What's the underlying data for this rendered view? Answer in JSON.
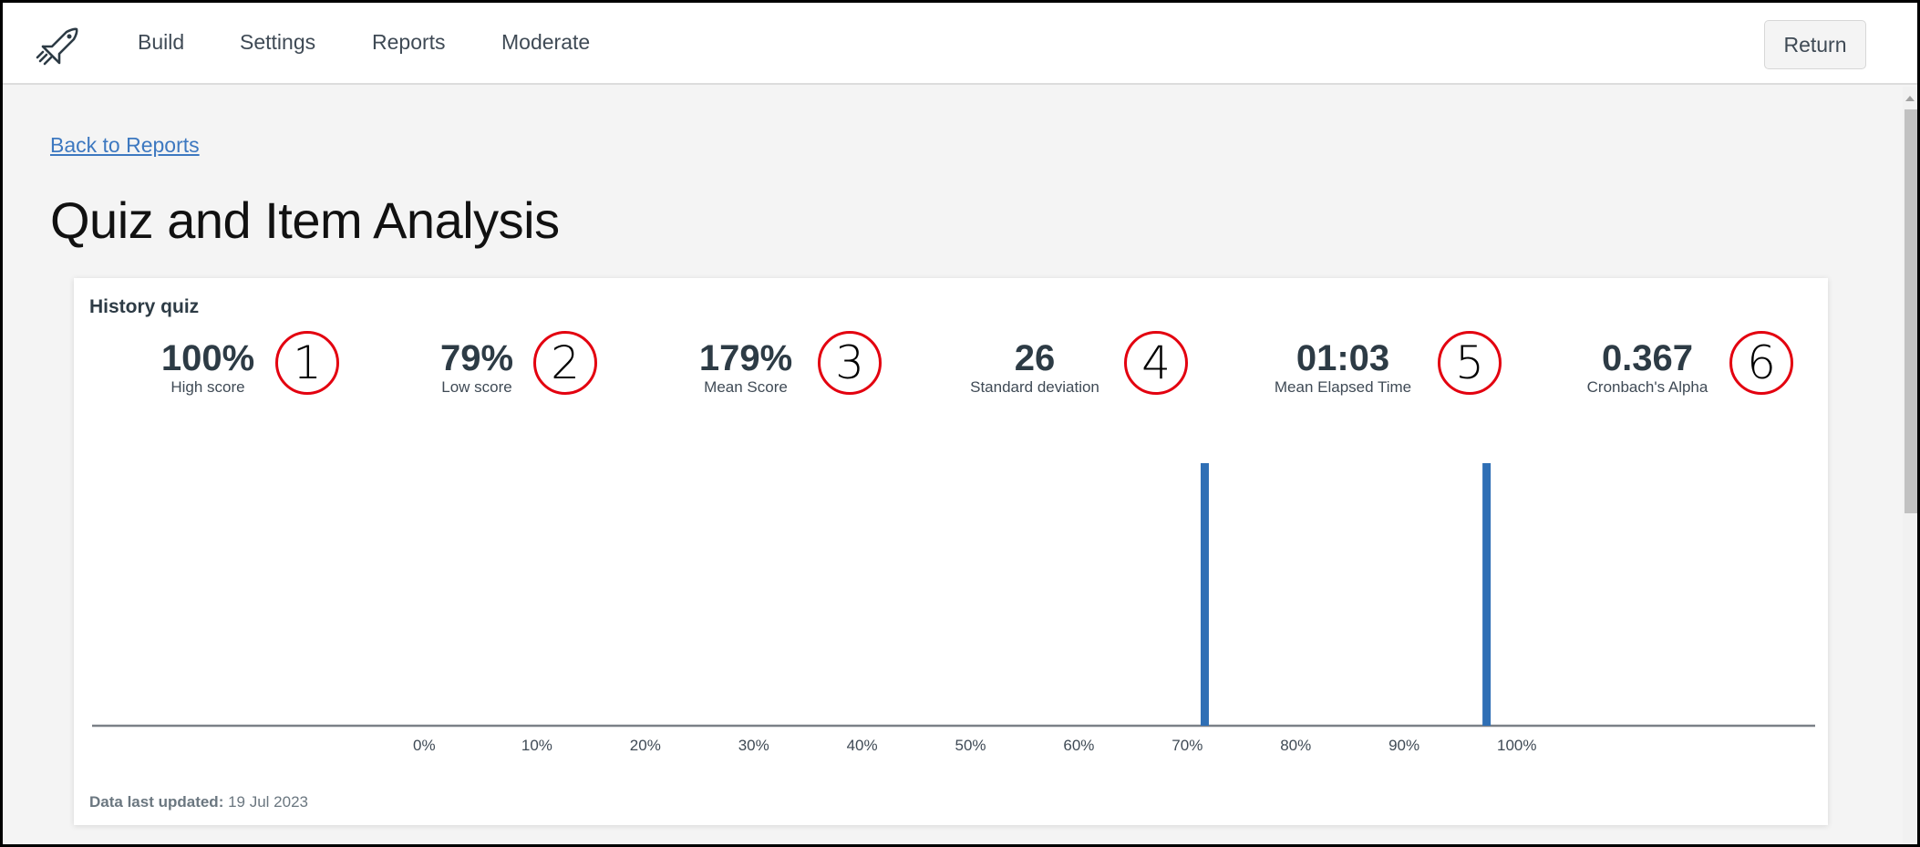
{
  "header": {
    "logo_icon": "rocket-icon",
    "nav": [
      {
        "label": "Build"
      },
      {
        "label": "Settings"
      },
      {
        "label": "Reports"
      },
      {
        "label": "Moderate"
      }
    ],
    "return_label": "Return"
  },
  "page": {
    "back_link": "Back to Reports",
    "title": "Quiz and Item Analysis"
  },
  "panel": {
    "quiz_name": "History quiz",
    "stats": [
      {
        "value": "100%",
        "label": "High score",
        "annotation": "1"
      },
      {
        "value": "79%",
        "label": "Low score",
        "annotation": "2"
      },
      {
        "value": "179%",
        "label": "Mean Score",
        "annotation": "3"
      },
      {
        "value": "26",
        "label": "Standard deviation",
        "annotation": "4"
      },
      {
        "value": "01:03",
        "label": "Mean Elapsed Time",
        "annotation": "5"
      },
      {
        "value": "0.367",
        "label": "Cronbach's Alpha",
        "annotation": "6"
      }
    ],
    "footer_label": "Data last updated:",
    "footer_value": "19 Jul 2023"
  },
  "colors": {
    "bar": "#2f6fb5",
    "axis": "#7b8087",
    "annotation": "#e3000f"
  },
  "chart_data": {
    "type": "bar",
    "title": "",
    "xlabel": "",
    "ylabel": "",
    "x_ticks": [
      "0%",
      "10%",
      "20%",
      "30%",
      "40%",
      "50%",
      "60%",
      "70%",
      "80%",
      "90%",
      "100%"
    ],
    "xlim": [
      0,
      100
    ],
    "x": [
      73,
      99
    ],
    "values": [
      1,
      1
    ],
    "ylim": [
      0,
      1
    ],
    "grid": false,
    "legend": "none"
  }
}
